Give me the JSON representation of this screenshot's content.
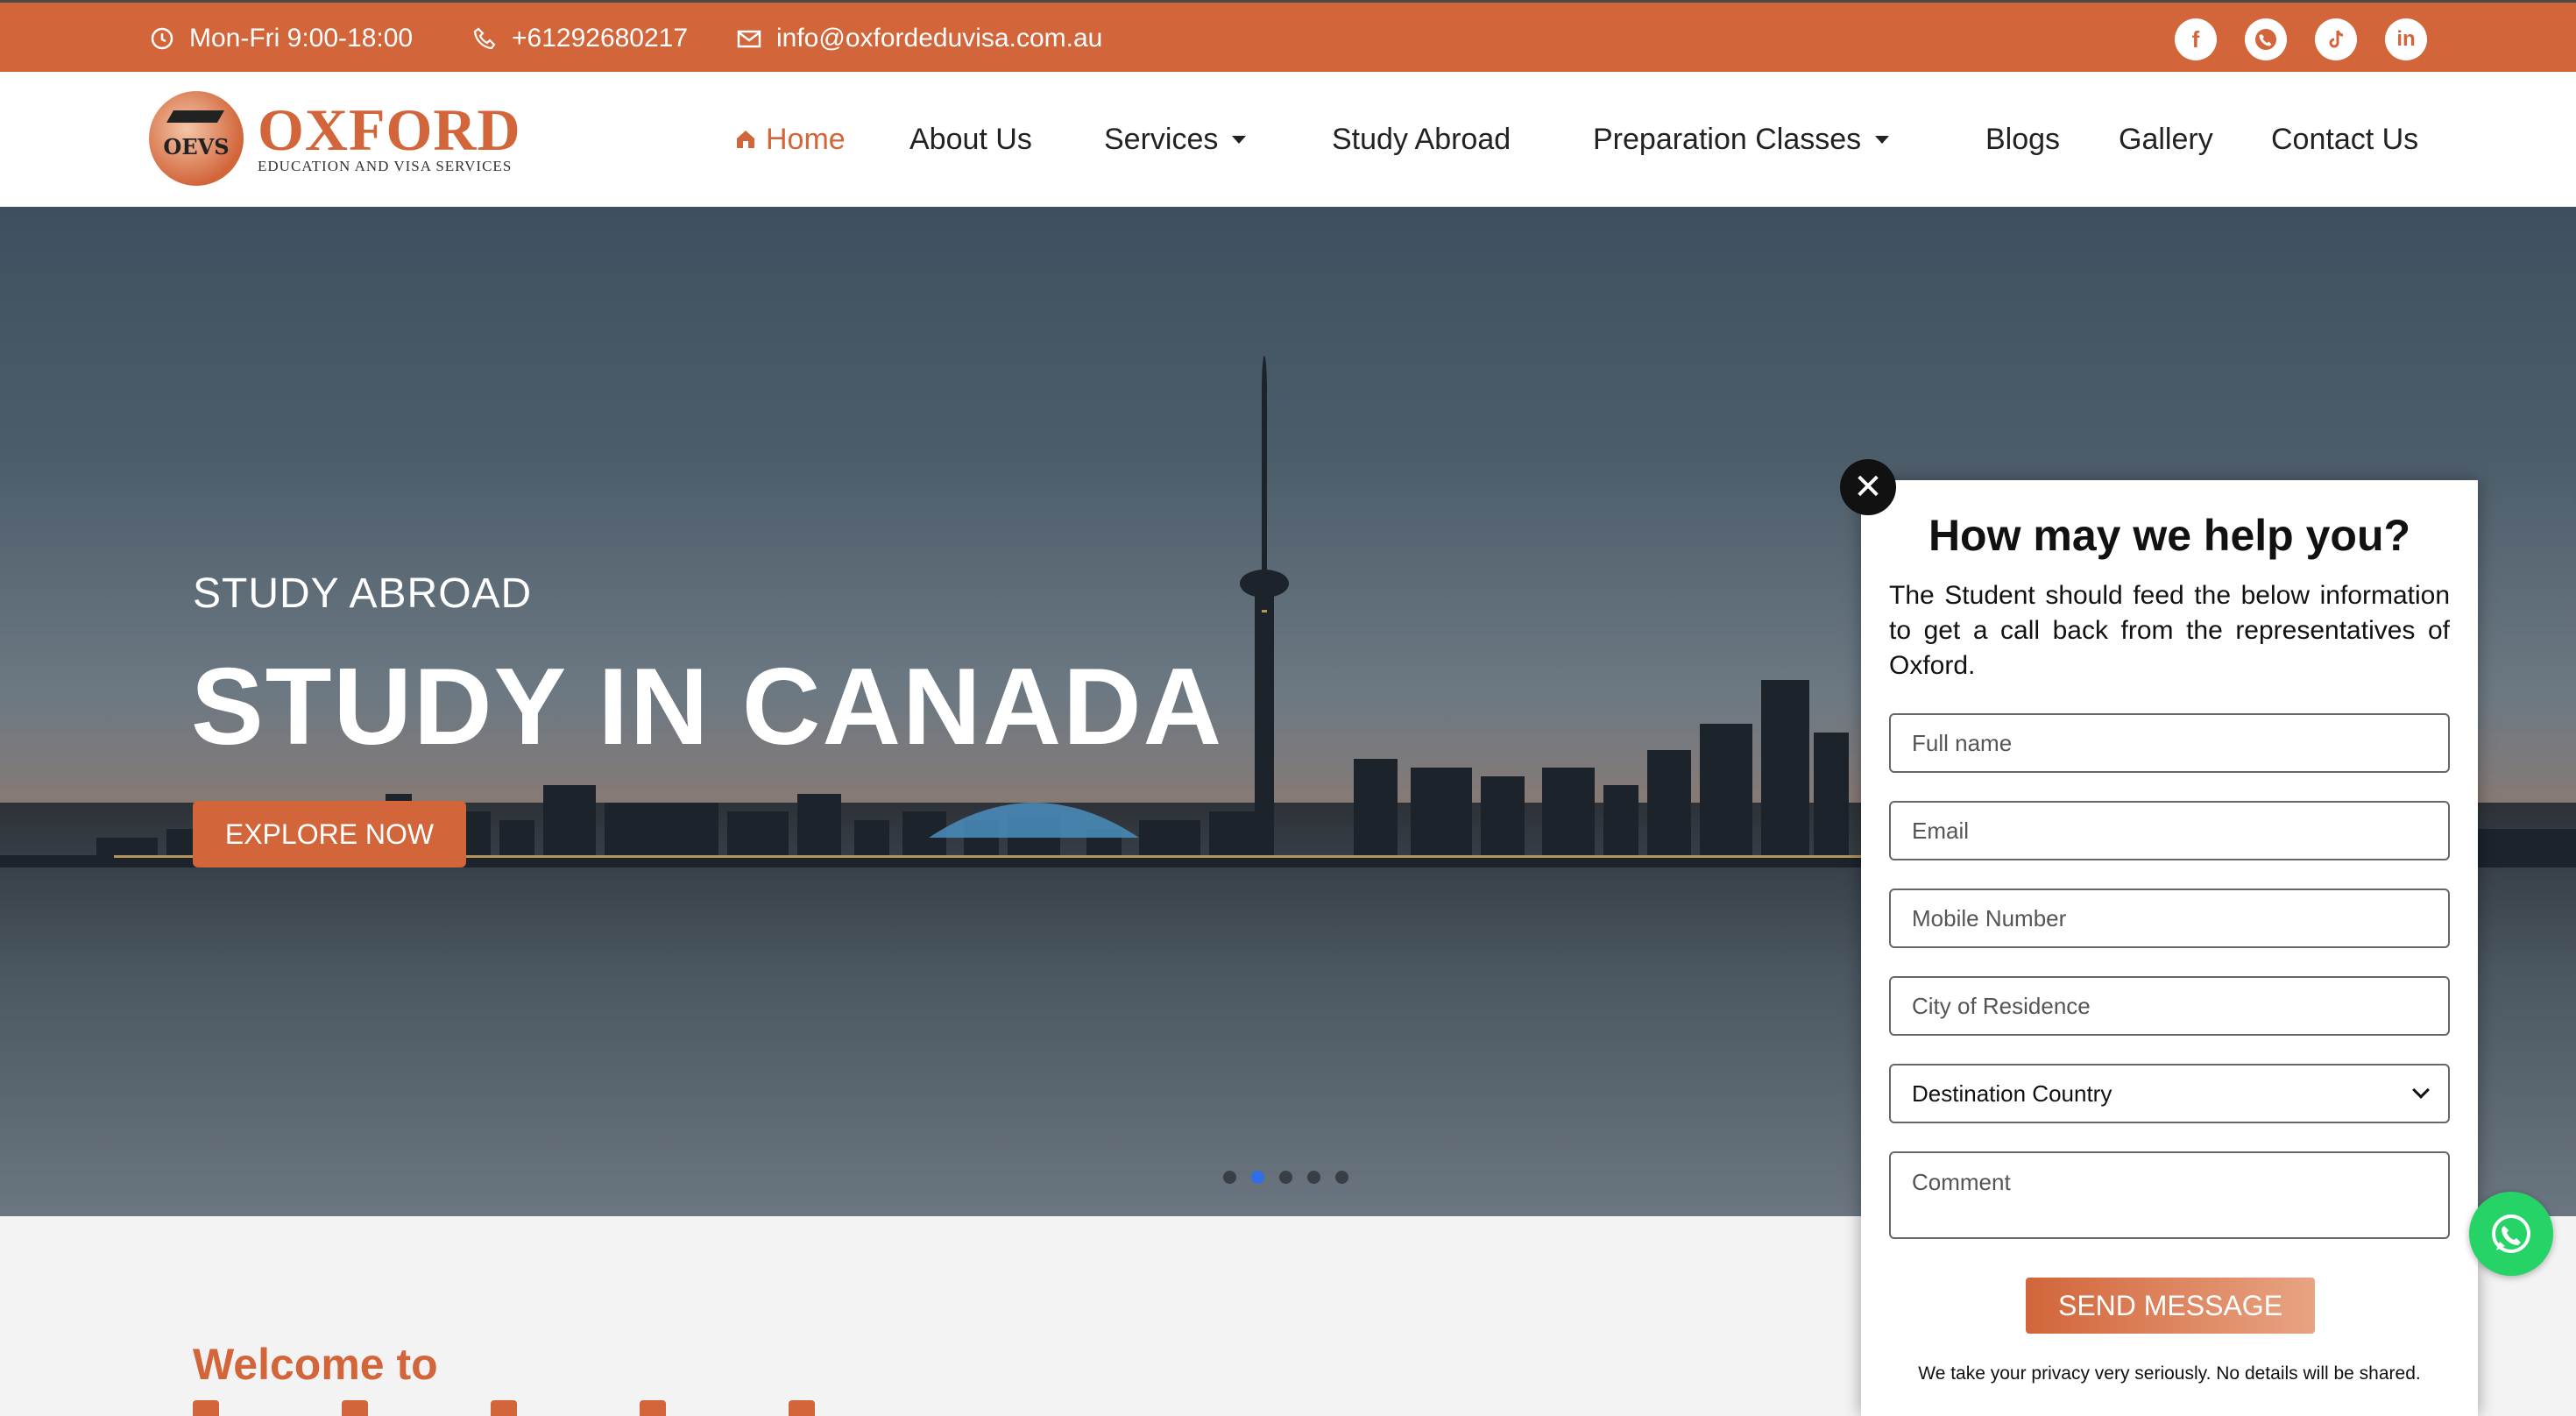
{
  "topbar": {
    "hours": "Mon-Fri 9:00-18:00",
    "phone": "+61292680217",
    "email": "info@oxfordeduvisa.com.au",
    "social": [
      "facebook-icon",
      "whatsapp-icon",
      "tiktok-icon",
      "linkedin-icon"
    ],
    "bg_color": "#d2653a"
  },
  "logo": {
    "mark_text": "OEVS",
    "name": "OXFORD",
    "tagline": "EDUCATION AND VISA SERVICES"
  },
  "nav": {
    "items": [
      {
        "label": "Home",
        "active": true
      },
      {
        "label": "About Us"
      },
      {
        "label": "Services",
        "dropdown": true
      },
      {
        "label": "Study Abroad"
      },
      {
        "label": "Preparation Classes",
        "dropdown": true
      },
      {
        "label": "Blogs"
      },
      {
        "label": "Gallery"
      },
      {
        "label": "Contact Us"
      }
    ]
  },
  "hero": {
    "overline": "STUDY ABROAD",
    "headline": "STUDY IN CANADA",
    "cta_label": "EXPLORE NOW",
    "slides": 5,
    "active_slide": 2
  },
  "welcome": {
    "heading": "Welcome to"
  },
  "popup": {
    "close_glyph": "✕",
    "title": "How may we help you?",
    "description": "The Student should feed the below information to get a call back from the representatives of Oxford.",
    "fields": {
      "full_name": "Full name",
      "email": "Email",
      "mobile": "Mobile Number",
      "city": "City of Residence",
      "destination": "Destination Country",
      "comment": "Comment"
    },
    "send_label": "SEND MESSAGE",
    "privacy": "We take your privacy very seriously. No details will be shared."
  },
  "accent_color": "#d2653a"
}
